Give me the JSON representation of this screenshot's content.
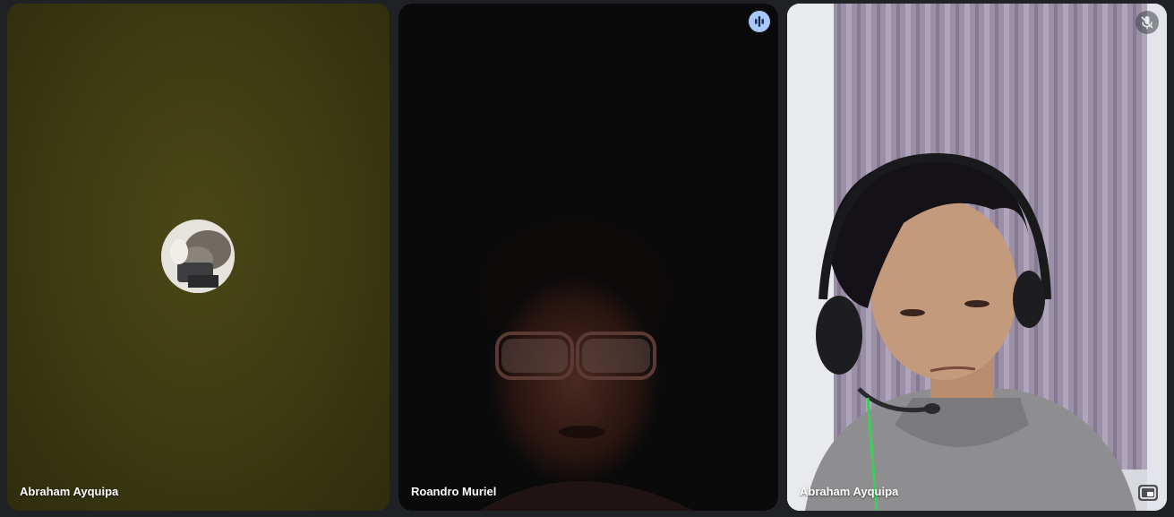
{
  "participants": [
    {
      "name": "Abraham Ayquipa",
      "video": "off",
      "avatar": "profile-photo-icon"
    },
    {
      "name": "Roandro Muriel",
      "video": "on",
      "speaking": true,
      "indicator_icon": "audio-level-icon"
    },
    {
      "name": "Abraham Ayquipa",
      "video": "on",
      "muted": true,
      "indicator_icon": "mic-off-icon",
      "action_icon": "picture-in-picture-icon"
    }
  ],
  "colors": {
    "background": "#202124",
    "active_speaker_border": "#a8c7fa",
    "label_text": "#ffffff"
  }
}
